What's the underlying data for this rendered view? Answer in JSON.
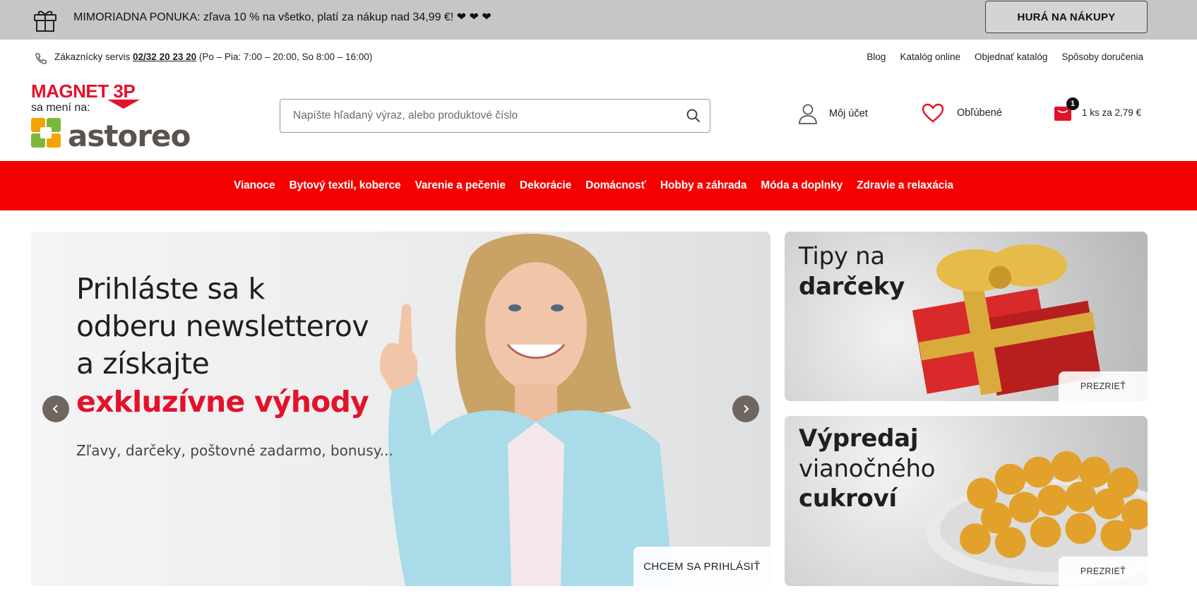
{
  "promo": {
    "text": "MIMORIADNA PONUKA: zľava 10 % na všetko, platí za nákup nad 34,99 €! ❤ ❤ ❤",
    "cta": "HURÁ NA NÁKUPY"
  },
  "util": {
    "service_prefix": "Zákaznícky servis ",
    "service_phone": "02/32 20 23 20",
    "service_hours": " (Po – Pia: 7:00 – 20:00, So 8:00 – 16:00)",
    "links": [
      "Blog",
      "Katalóg online",
      "Objednať katalóg",
      "Spôsoby doručenia"
    ]
  },
  "logo": {
    "old_brand": "MAGNET 3P",
    "changes_to": "sa mení na:",
    "new_brand": "astoreo"
  },
  "search": {
    "placeholder": "Napíšte hľadaný výraz, alebo produktové číslo",
    "value": ""
  },
  "header": {
    "account_label": "Môj účet",
    "favorites_label": "Obľúbené",
    "cart_count": "1",
    "cart_summary": "1 ks za 2,79 €"
  },
  "nav": [
    "Vianoce",
    "Bytový textil, koberce",
    "Varenie a pečenie",
    "Dekorácie",
    "Domácnosť",
    "Hobby a záhrada",
    "Móda a doplnky",
    "Zdravie a relaxácia"
  ],
  "hero": {
    "line1": "Prihláste sa k",
    "line2": "odberu newsletterov",
    "line3": "a získajte",
    "accent": "exkluzívne výhody",
    "sub": "Zľavy, darčeky, poštovné zadarmo, bonusy...",
    "cta": "CHCEM SA PRIHLÁSIŤ"
  },
  "tiles": [
    {
      "line1": "Tipy na",
      "line2": "darčeky",
      "cta": "PREZRIEŤ"
    },
    {
      "line1": "Výpredaj",
      "line2": "vianočného",
      "line3": "cukroví",
      "cta": "PREZRIEŤ"
    }
  ],
  "colors": {
    "nav_red": "#f50000",
    "accent_red": "#e3122b",
    "promo_grey": "#c6c6c6"
  }
}
